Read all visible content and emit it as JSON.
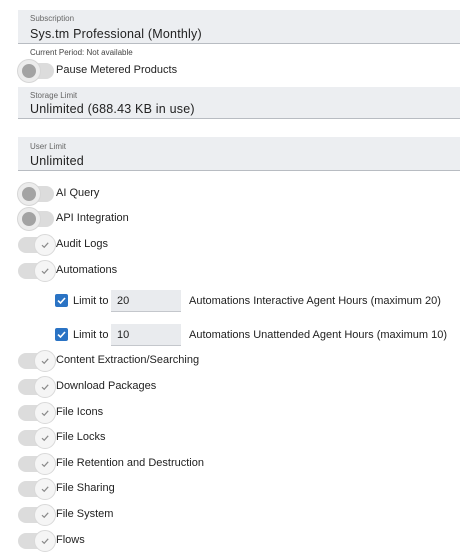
{
  "subscription": {
    "label": "Subscription",
    "value": "Sys.tm Professional (Monthly)"
  },
  "current_period": "Current Period: Not available",
  "pause_metered": {
    "label": "Pause Metered Products",
    "enabled": false
  },
  "storage_limit": {
    "label": "Storage Limit",
    "value": "Unlimited (688.43 KB in use)"
  },
  "user_limit": {
    "label": "User Limit",
    "value": "Unlimited"
  },
  "features": [
    {
      "label": "AI Query",
      "enabled": false
    },
    {
      "label": "API Integration",
      "enabled": false
    },
    {
      "label": "Audit Logs",
      "enabled": true
    },
    {
      "label": "Automations",
      "enabled": true
    },
    {
      "label": "Content Extraction/Searching",
      "enabled": true
    },
    {
      "label": "Download Packages",
      "enabled": true
    },
    {
      "label": "File Icons",
      "enabled": true
    },
    {
      "label": "File Locks",
      "enabled": true
    },
    {
      "label": "File Retention and Destruction",
      "enabled": true
    },
    {
      "label": "File Sharing",
      "enabled": true
    },
    {
      "label": "File System",
      "enabled": true
    },
    {
      "label": "Flows",
      "enabled": true
    }
  ],
  "automation_limits": [
    {
      "checked": true,
      "label": "Limit to",
      "value": "20",
      "description": "Automations Interactive Agent Hours (maximum 20)"
    },
    {
      "checked": true,
      "label": "Limit to",
      "value": "10",
      "description": "Automations Unattended Agent Hours (maximum 10)"
    }
  ],
  "colors": {
    "checkbox_accent": "#2a73c4",
    "field_background": "#eceef1"
  }
}
